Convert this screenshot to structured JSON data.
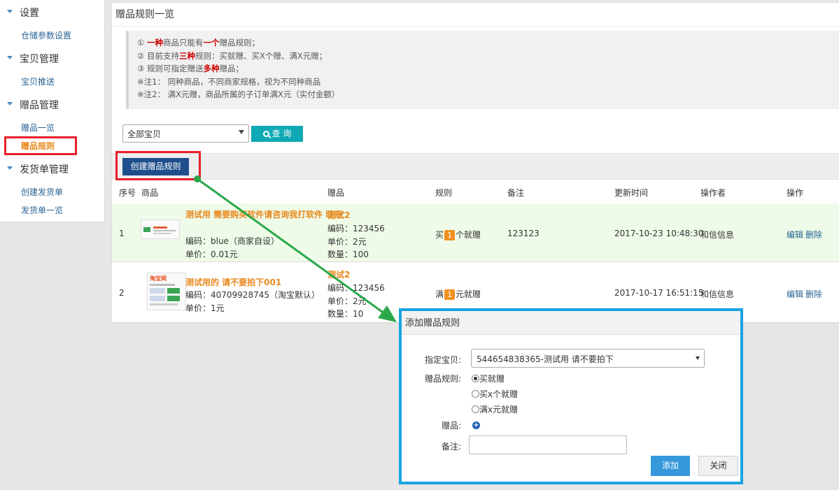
{
  "sidebar": {
    "groups": [
      {
        "title": "设置",
        "items": [
          {
            "label": "仓储参数设置"
          }
        ]
      },
      {
        "title": "宝贝管理",
        "items": [
          {
            "label": "宝贝推送"
          }
        ]
      },
      {
        "title": "赠品管理",
        "items": [
          {
            "label": "赠品一览"
          },
          {
            "label": "赠品规则"
          }
        ]
      },
      {
        "title": "发货单管理",
        "items": [
          {
            "label": "创建发货单"
          },
          {
            "label": "发货单一览"
          }
        ]
      }
    ]
  },
  "page": {
    "title": "赠品规则一览",
    "notice": {
      "line1": {
        "a": "① ",
        "b": "一种",
        "c": "商品只能有",
        "d": "一个",
        "e": "赠品规则；"
      },
      "line2": {
        "a": "② 目前支持",
        "b": "三种",
        "c": "规则：买就赠、买X个赠、满X元赠；"
      },
      "line3": {
        "a": "③ 规则可指定赠送",
        "b": "多种",
        "c": "赠品；"
      },
      "line4": "※注1： 同种商品，不同商家规格，视为不同种商品",
      "line5": "※注2： 满X元赠，商品所属的子订单满X元（实付金额）"
    },
    "filter": {
      "selected": "全部宝贝",
      "search_label": "查 询"
    },
    "create_label": "创建赠品规则"
  },
  "table": {
    "headers": [
      "序号",
      "商品",
      "赠品",
      "规则",
      "备注",
      "更新时间",
      "操作者",
      "操作"
    ],
    "rows": [
      {
        "no": "1",
        "product_name": "测试用 需要购买软件请咨询我打软件 旺旺",
        "product_code": "编码：blue（商家自设）",
        "product_price": "单价：0.01元",
        "gift_name": "测试2",
        "gift_code": "编码：123456",
        "gift_price": "单价：2元",
        "gift_qty": "数量：100",
        "rule_prefix": "买",
        "rule_num": "1",
        "rule_suffix": "个就赠",
        "note": "123123",
        "updated": "2017-10-23 10:48:30",
        "operator": "和信信息",
        "edit": "编辑",
        "delete": "删除"
      },
      {
        "no": "2",
        "product_name": "测试用的 请不要拍下001",
        "product_code": "编码：40709928745（淘宝默认）",
        "product_price": "单价：1元",
        "thumb_logo": "淘宝网",
        "gift_name": "测试2",
        "gift_code": "编码：123456",
        "gift_price": "单价：2元",
        "gift_qty": "数量：10",
        "rule_prefix": "满",
        "rule_num": "1",
        "rule_suffix": "元就赠",
        "note": "",
        "updated": "2017-10-17 16:51:15",
        "operator": "和信信息",
        "edit": "编辑",
        "delete": "删除"
      }
    ]
  },
  "modal": {
    "title": "添加赠品规则",
    "item_label": "指定宝贝:",
    "item_selected": "544654838365-测试用 请不要拍下",
    "rule_label": "赠品规则:",
    "rule_options": [
      "买就赠",
      "买x个就赠",
      "满x元就赠"
    ],
    "gift_label": "赠品:",
    "note_label": "备注:",
    "add_label": "添加",
    "close_label": "关闭"
  },
  "colors": {
    "highlight_box": "#e81f2a",
    "modal_border": "#1aa3e0",
    "arrow": "#2aa84a",
    "primary_button": "#1f4e8c",
    "search_button": "#0fa9b5"
  }
}
